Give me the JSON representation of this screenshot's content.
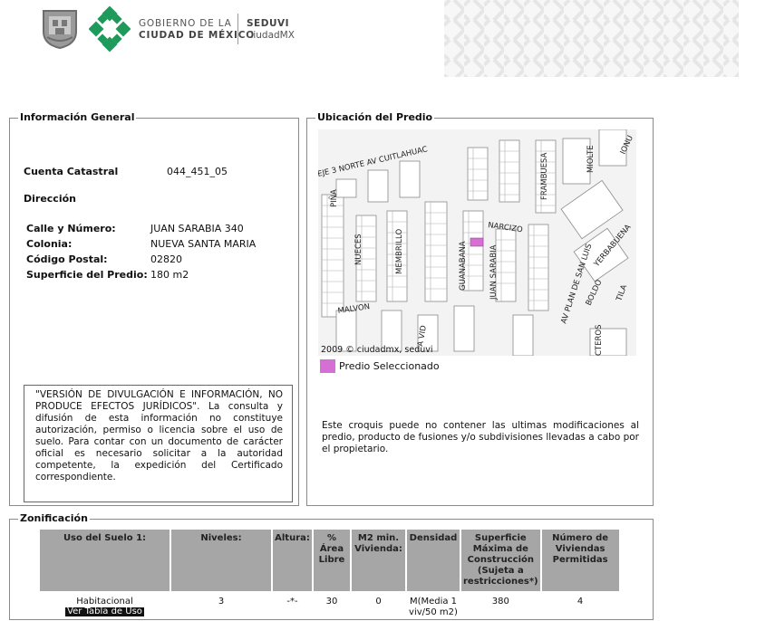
{
  "header": {
    "gov_line1": "GOBIERNO DE LA",
    "gov_line2": "CIUDAD DE MÉXICO",
    "agency": "SEDUVI",
    "agency_sub": "CiudadMX"
  },
  "general": {
    "legend": "Información General",
    "cuenta_label": "Cuenta Catastral",
    "cuenta_value": "044_451_05",
    "direccion_label": "Dirección",
    "rows": [
      {
        "label": "Calle y Número:",
        "value": "JUAN SARABIA 340"
      },
      {
        "label": "Colonia:",
        "value": "NUEVA SANTA MARIA"
      },
      {
        "label": "Código Postal:",
        "value": "02820"
      },
      {
        "label": "Superficie del Predio:",
        "value": "180 m2"
      }
    ],
    "disclaimer": "\"VERSIÓN DE DIVULGACIÓN E INFORMACIÓN, NO PRODUCE EFECTOS JURÍDICOS\". La consulta y difusión de esta información no constituye autorización, permiso o licencia sobre el uso de suelo. Para contar con un documento de carácter oficial es necesario solicitar a la autoridad competente, la expedición del Certificado correspondiente."
  },
  "ubicacion": {
    "legend": "Ubicación del Predio",
    "streets": {
      "cuitlahuac": "EJE 3 NORTE AV CUITLAHUAC",
      "pina": "PIÑA",
      "nueces": "NUECES",
      "membrillo": "MEMBRILLO",
      "guanabana": "GUANABANA",
      "juan_sarabia": "JUAN SARABIA",
      "narcizo": "NARCIZO",
      "frambuesa": "FRAMBUESA",
      "miolte": "MIOLTE",
      "ionu": "IONU",
      "yerbabuena": "YERBABUENA",
      "tila": "TILA",
      "boldo": "BOLDO",
      "plan_san_luis": "AV PLAN DE SAN LUIS",
      "malvon": "MALVON",
      "vid": "A VID",
      "cteros": "CTEROS"
    },
    "credit": "2009 © ciudadmx, seduvi",
    "legend_label": "Predio Seleccionado",
    "legend_color": "#d56fd3",
    "note": "Este croquis puede no contener las ultimas modificaciones al predio, producto de fusiones y/o subdivisiones llevadas a cabo por el propietario."
  },
  "zonificacion": {
    "legend": "Zonificación",
    "headers": [
      "Uso del Suelo 1:",
      "Niveles:",
      "Altura:",
      "% Área Libre",
      "M2 min. Vivienda:",
      "Densidad",
      "Superficie Máxima de Construcción (Sujeta a restricciones*)",
      "Número de Viviendas Permitidas"
    ],
    "row": {
      "uso": "Habitacional",
      "uso_link": "Ver Tabla de Uso",
      "niveles": "3",
      "altura": "-*-",
      "area_libre": "30",
      "m2_min": "0",
      "densidad": "M(Media 1 viv/50 m2)",
      "superficie": "380",
      "viviendas": "4"
    }
  }
}
